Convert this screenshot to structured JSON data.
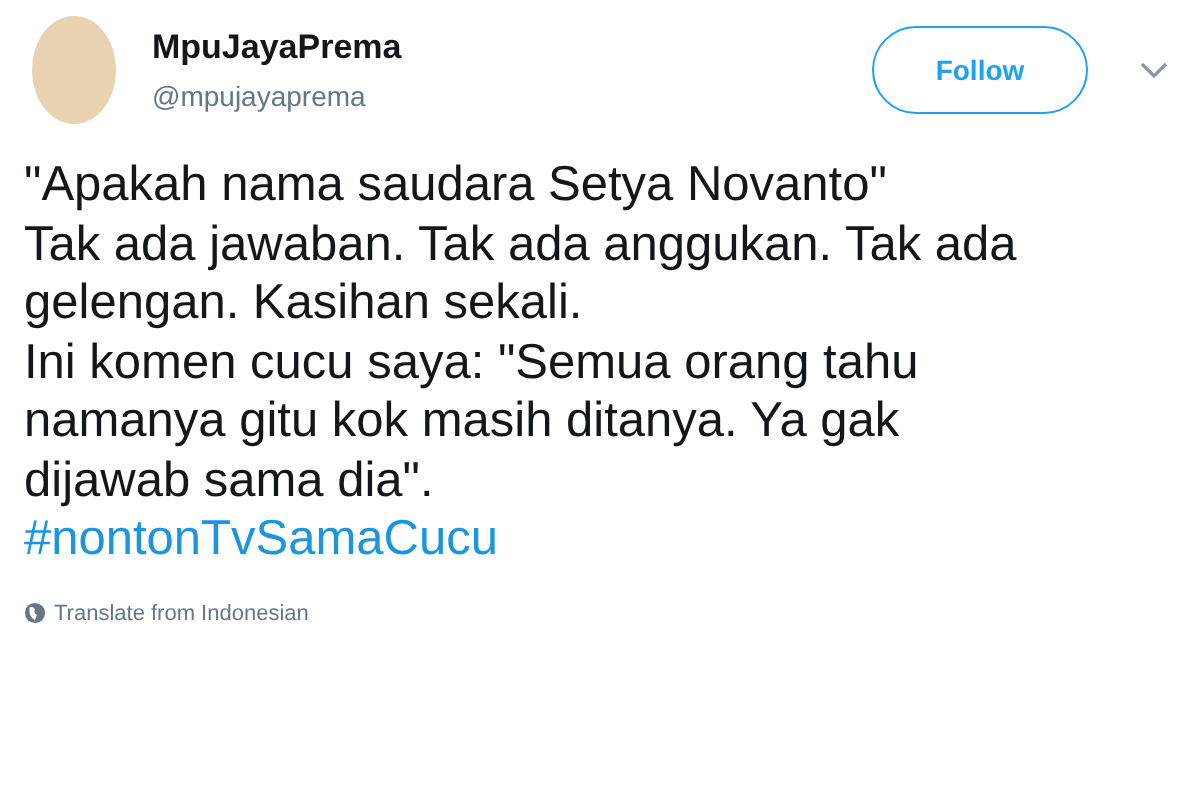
{
  "user": {
    "name": "MpuJayaPrema",
    "handle": "@mpujayaprema"
  },
  "follow_button": "Follow",
  "tweet_lines": [
    "\"Apakah nama saudara Setya Novanto\"",
    "Tak ada jawaban. Tak ada anggukan. Tak ada",
    "gelengan. Kasihan sekali.",
    "Ini komen cucu saya: \"Semua orang tahu",
    "namanya gitu kok masih ditanya. Ya gak",
    "dijawab sama dia\"."
  ],
  "hashtag": "#nontonTvSamaCucu",
  "translate_link": "Translate from Indonesian"
}
